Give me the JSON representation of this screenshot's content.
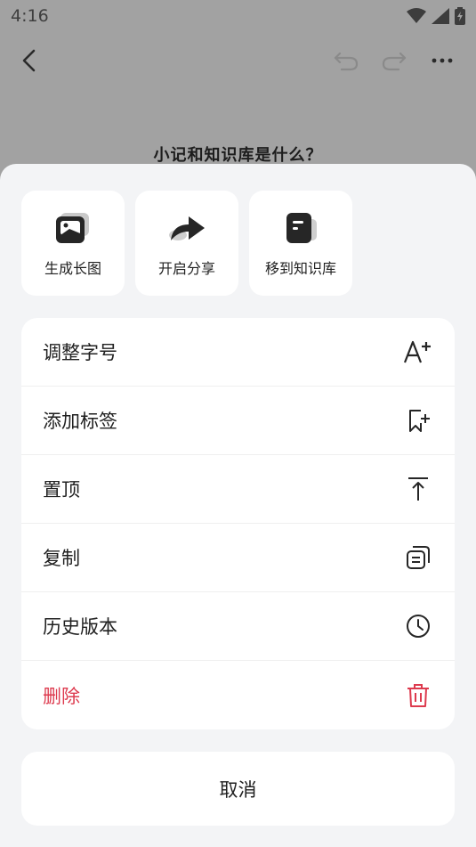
{
  "status_bar": {
    "time": "4:16"
  },
  "document": {
    "title": "小记和知识库是什么？"
  },
  "quick_actions": [
    {
      "label": "生成长图",
      "icon": "image-icon"
    },
    {
      "label": "开启分享",
      "icon": "share-icon"
    },
    {
      "label": "移到知识库",
      "icon": "knowledge-base-icon"
    }
  ],
  "menu": {
    "items": [
      {
        "label": "调整字号",
        "icon": "font-size-icon"
      },
      {
        "label": "添加标签",
        "icon": "add-tag-icon"
      },
      {
        "label": "置顶",
        "icon": "pin-top-icon"
      },
      {
        "label": "复制",
        "icon": "copy-icon"
      },
      {
        "label": "历史版本",
        "icon": "history-icon"
      },
      {
        "label": "删除",
        "icon": "delete-icon"
      }
    ]
  },
  "cancel_label": "取消",
  "colors": {
    "danger": "#dd3a4e",
    "sheet_bg": "#f3f4f6",
    "card_bg": "#ffffff"
  }
}
